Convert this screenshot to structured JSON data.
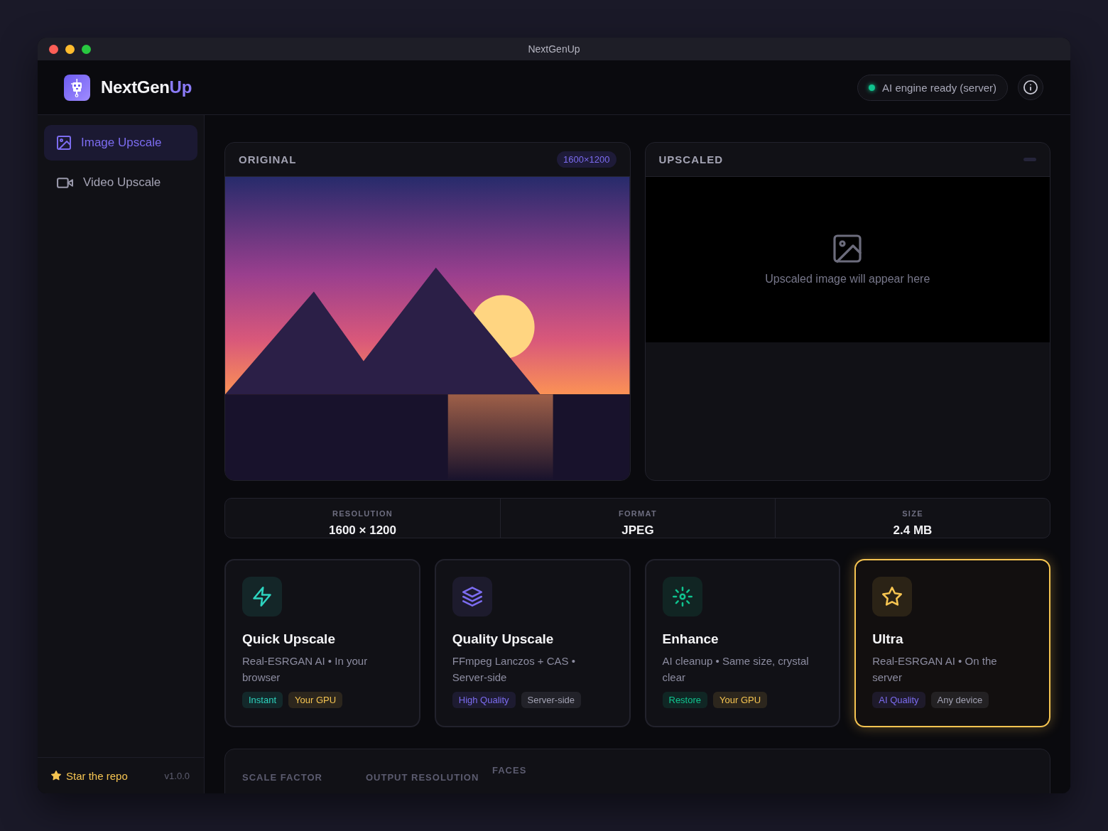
{
  "window": {
    "title": "NextGenUp"
  },
  "header": {
    "brand": {
      "name": "NextGen",
      "accent": "Up"
    },
    "status": {
      "text": "AI engine ready (server)",
      "online": true
    }
  },
  "sidebar": {
    "items": [
      {
        "label": "Image Upscale",
        "selected": true
      },
      {
        "label": "Video Upscale",
        "selected": false
      }
    ],
    "footer": {
      "link": "Star the repo",
      "version": "v1.0.0"
    }
  },
  "previews": [
    {
      "kind": "image",
      "title": "ORIGINAL",
      "badge": "1600×1200"
    },
    {
      "kind": "empty",
      "title": "UPSCALED",
      "empty_text": "Upscaled image will appear here"
    }
  ],
  "stats": [
    {
      "label": "RESOLUTION",
      "value": "1600 × 1200"
    },
    {
      "label": "FORMAT",
      "value": "JPEG"
    },
    {
      "label": "SIZE",
      "value": "2.4 MB"
    }
  ],
  "modes": [
    {
      "title": "Quick Upscale",
      "description": "Real-ESRGAN AI • In your browser",
      "color": "#2dd4bf",
      "selected": false,
      "tags": [
        {
          "label": "Instant",
          "color": "#2dd4bf"
        },
        {
          "label": "Your GPU",
          "color": "#f5c451"
        }
      ]
    },
    {
      "title": "Quality Upscale",
      "description": "FFmpeg Lanczos + CAS • Server-side",
      "color": "#7c6cf0",
      "selected": false,
      "tags": [
        {
          "label": "High Quality",
          "color": "#7c6cf0"
        },
        {
          "label": "Server-side",
          "color": "#a1a1b2"
        }
      ]
    },
    {
      "title": "Enhance",
      "description": "AI cleanup • Same size, crystal clear",
      "color": "#10c48f",
      "selected": false,
      "tags": [
        {
          "label": "Restore",
          "color": "#10c48f"
        },
        {
          "label": "Your GPU",
          "color": "#f5c451"
        }
      ]
    },
    {
      "title": "Ultra",
      "description": "Real-ESRGAN AI • On the server",
      "color": "#f5c451",
      "selected": true,
      "tags": [
        {
          "label": "AI Quality",
          "color": "#7c6cf0"
        },
        {
          "label": "Any device",
          "color": "#a1a1b2"
        }
      ]
    }
  ],
  "settings": {
    "labels": [
      "SCALE FACTOR",
      "OUTPUT RESOLUTION",
      "FACES"
    ]
  }
}
